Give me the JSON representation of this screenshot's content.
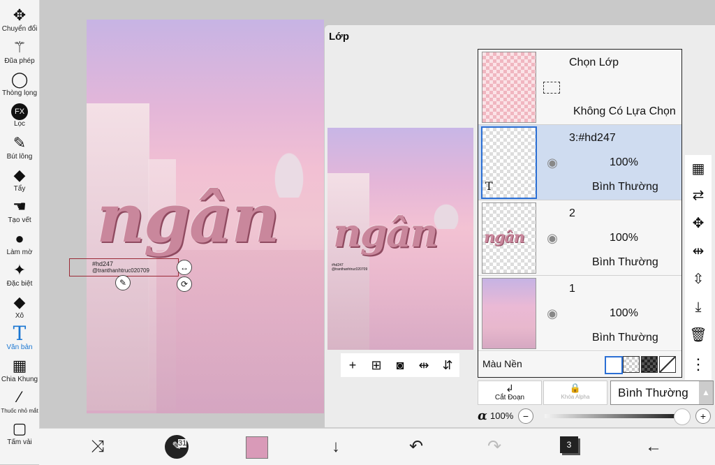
{
  "tools": [
    {
      "label": "Chuyển đổi",
      "icon": "move-icon",
      "glyph": "✥"
    },
    {
      "label": "Đũa phép",
      "icon": "magic-wand-icon",
      "glyph": "⚚"
    },
    {
      "label": "Thòng lọng",
      "icon": "lasso-icon",
      "glyph": "◯"
    },
    {
      "label": "Lọc",
      "icon": "filter-fx-icon",
      "glyph": "FX"
    },
    {
      "label": "Bút lông",
      "icon": "brush-icon",
      "glyph": "✎"
    },
    {
      "label": "Tẩy",
      "icon": "eraser-icon",
      "glyph": "◆"
    },
    {
      "label": "Tạo vết",
      "icon": "smudge-icon",
      "glyph": "☚"
    },
    {
      "label": "Làm mờ",
      "icon": "blur-drop-icon",
      "glyph": "●"
    },
    {
      "label": "Đặc biệt",
      "icon": "special-sparkle-icon",
      "glyph": "✦"
    },
    {
      "label": "Xô",
      "icon": "bucket-icon",
      "glyph": "◆"
    },
    {
      "label": "Văn bản",
      "icon": "text-icon",
      "glyph": "T"
    },
    {
      "label": "Chia Khung",
      "icon": "frame-divider-icon",
      "glyph": "▦"
    },
    {
      "label": "Thuốc nhỏ mắt",
      "icon": "eyedropper-icon",
      "glyph": "⁄"
    },
    {
      "label": "Tấm vải",
      "icon": "canvas-icon",
      "glyph": "▢"
    }
  ],
  "canvas": {
    "word": "ngân",
    "text_line1": "#hd247",
    "text_line2": "@tranthanhtruc020709"
  },
  "panel": {
    "title": "Lớp",
    "select_layer": {
      "title": "Chọn Lớp",
      "status": "Không Có Lựa Chọn"
    },
    "layers": [
      {
        "name": "3:#hd247",
        "opacity": "100%",
        "blend": "Bình Thường",
        "thumb_label": "T"
      },
      {
        "name": "2",
        "opacity": "100%",
        "blend": "Bình Thường",
        "thumb_label": "ngân"
      },
      {
        "name": "1",
        "opacity": "100%",
        "blend": "Bình Thường",
        "thumb_label": ""
      }
    ],
    "background_label": "Màu Nền",
    "clip_label": "Cắt Đoạn",
    "alpha_lock_label": "Khóa Alpha",
    "blend_mode": "Bình Thường",
    "alpha_symbol": "α",
    "opacity_value": "100%",
    "opacity_fraction": 1.0
  },
  "bottom": {
    "brush_size": "31",
    "layer_count": "3",
    "color": "#d99ab8"
  }
}
